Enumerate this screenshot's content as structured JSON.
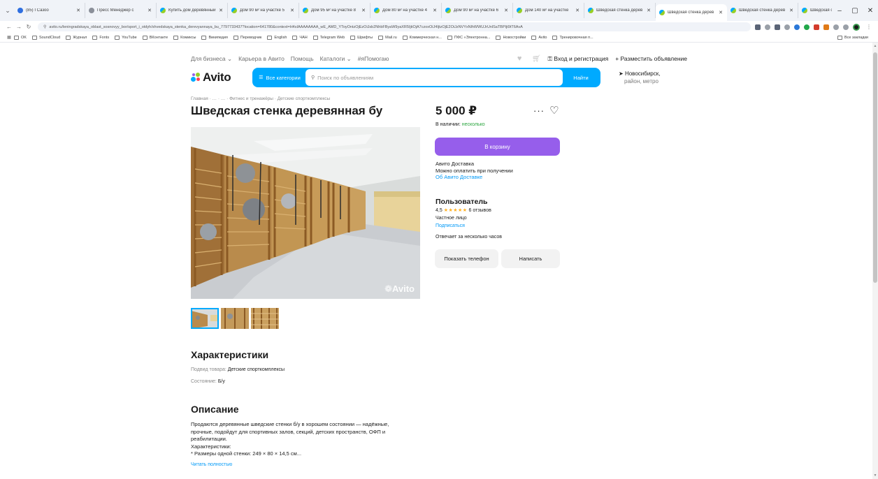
{
  "browser": {
    "tabs": [
      {
        "label": "(85) I Сазоо",
        "icon": "blue"
      },
      {
        "label": "Пресс Менеджер с",
        "icon": "gray"
      },
      {
        "label": "Купить дом деревянный",
        "icon": "avito"
      },
      {
        "label": "Дом 90 м² на участке 5",
        "icon": "avito"
      },
      {
        "label": "Дом 95 м² на участке 8",
        "icon": "avito"
      },
      {
        "label": "Дом 80 м² на участке 4",
        "icon": "avito"
      },
      {
        "label": "Дом 90 м² на участке 6",
        "icon": "avito"
      },
      {
        "label": "Дом 140 м² на участке",
        "icon": "avito"
      },
      {
        "label": "Шведская стенка дерев",
        "icon": "avito"
      },
      {
        "label": "Шведская стенка дерев",
        "icon": "avito",
        "active": true
      },
      {
        "label": "Шведская стенка дерев",
        "icon": "avito"
      },
      {
        "label": "Шведская стенка дерев",
        "icon": "avito"
      }
    ],
    "url": "avito.ru/leningradskaya_oblast_sosnovyy_bor/sport_i_otdyh/shvedskaya_stenka_derevyannaya_bu_7797733437?location=641780&context=H4sIAAAAAAAA_wE_AMD_YToyOntzOjEzOiJsb2NhbFByaW9yaXR5IjtiOjA7czoxOiJ4IjtzOjE2OiJzNVYxNlhWWUJrUnlSaTBPIjt9tT6AvA",
    "bookmarks": [
      "OK",
      "SoundCloud",
      "Журнал",
      "Fonts",
      "YouTube",
      "ВКонтакте",
      "Комиксы",
      "Википедия",
      "Переводчик",
      "English",
      "ЧАН",
      "Telegram Web",
      "Шрифты",
      "Mail.ru",
      "Коммерческая н...",
      "ПФС «Электронна...",
      "Новостройки",
      "Avito",
      "Тренировочная п..."
    ],
    "bookmarks_all": "Все закладки"
  },
  "topnav": {
    "items": [
      "Для бизнеса ⌄",
      "Карьера в Авито",
      "Помощь",
      "Каталоги ⌄",
      "#яПомогаю"
    ],
    "login": "Вход и регистрация",
    "post_ad": "+ Разместить объявление"
  },
  "header": {
    "logo": "Avito",
    "all_categories": "Все категории",
    "search_placeholder": "Поиск по объявлениям",
    "search_button": "Найти",
    "location_line1": "Новосибирск,",
    "location_line2": "район, метро"
  },
  "listing": {
    "breadcrumb": "Главная · … · … · Фитнес и тренажёры · Детские спорткомплексы",
    "title": "Шведская стенка деревянная бу",
    "price": "5 000 ₽",
    "stock_label": "В наличии:",
    "stock_value": "несколько",
    "cart_button": "В корзину",
    "delivery_line1": "Авито Доставка",
    "delivery_line2": "Можно оплатить при получении",
    "delivery_link": "Об Авито Доставке",
    "watermark": "Avito"
  },
  "seller": {
    "name": "Пользователь",
    "rating": "4,5",
    "stars": "★★★★★",
    "reviews": "6 отзывов",
    "type": "Частное лицо",
    "subscribe": "Подписаться",
    "responds": "Отвечает за несколько часов",
    "phone_button": "Показать телефон",
    "write_button": "Написать"
  },
  "characteristics": {
    "heading": "Характеристики",
    "rows": [
      {
        "key": "Подвид товара:",
        "value": "Детские спорткомплексы"
      },
      {
        "key": "Состояние:",
        "value": "Б/у"
      }
    ]
  },
  "description": {
    "heading": "Описание",
    "lines": [
      "Продаются деревянные шведские стенки б/у в хорошем состоянии — надёжные,",
      "прочные, подойдут для спортивных залов, секций, детских пространств, ОФП и",
      "реабилитации.",
      "Характеристики:",
      "* Размеры одной стенки: 249 × 80 × 14,5 см..."
    ],
    "read_more": "Читать полностью"
  },
  "colors": {
    "avito_blue": "#00aaff",
    "cart_purple": "#965eeb",
    "link_blue": "#0099f7",
    "stock_green": "#2aa53e"
  }
}
